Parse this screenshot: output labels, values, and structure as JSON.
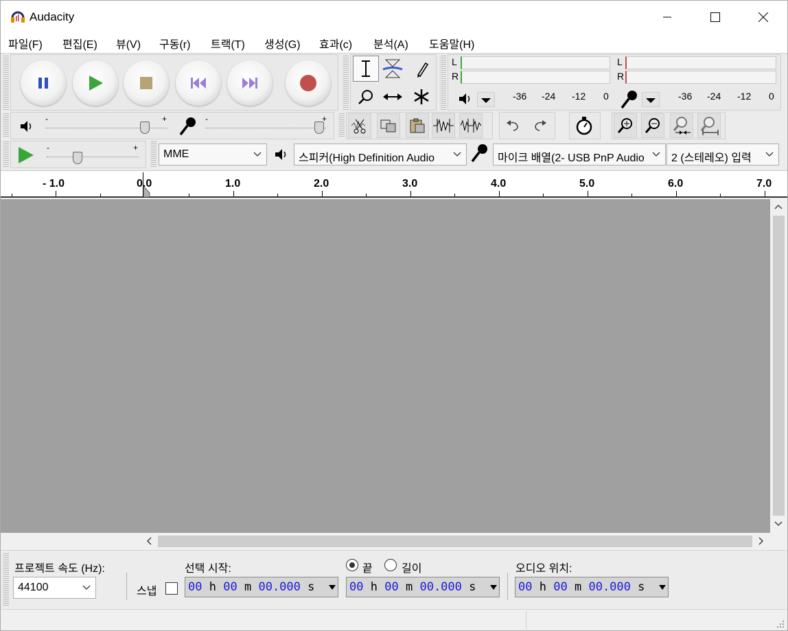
{
  "window": {
    "title": "Audacity"
  },
  "menu": [
    {
      "label": "파일(F)"
    },
    {
      "label": "편집(E)"
    },
    {
      "label": "뷰(V)"
    },
    {
      "label": "구동(r)"
    },
    {
      "label": "트랙(T)"
    },
    {
      "label": "생성(G)"
    },
    {
      "label": "효과(c)"
    },
    {
      "label": "분석(A)"
    },
    {
      "label": "도움말(H)"
    }
  ],
  "meters": {
    "playback": {
      "left": "L",
      "right": "R",
      "scale": [
        "-36",
        "-24",
        "-12",
        "0"
      ]
    },
    "record": {
      "left": "L",
      "right": "R",
      "scale": [
        "-36",
        "-24",
        "-12",
        "0"
      ]
    }
  },
  "sliders": {
    "minus": "-",
    "plus": "+"
  },
  "device": {
    "host": "MME",
    "output": "스피커(High Definition Audio",
    "input": "마이크 배열(2- USB PnP Audio",
    "channels": "2 (스테레오) 입력"
  },
  "ruler": {
    "labels": [
      "- 1.0",
      "0.0",
      "1.0",
      "2.0",
      "3.0",
      "4.0",
      "5.0",
      "6.0",
      "7.0"
    ]
  },
  "selection": {
    "rate_label": "프로젝트 속도 (Hz):",
    "rate_value": "44100",
    "snap_label": "스냅",
    "start_label": "선택 시작:",
    "end_label": "끝",
    "length_label": "길이",
    "position_label": "오디오 위치:",
    "time": {
      "hh": "00",
      "h": "h",
      "mm": "00",
      "m": "m",
      "ss": "00.000",
      "s": "s"
    }
  },
  "colors": {
    "play_green": "#3aa63a",
    "record_red": "#c0504d",
    "time_digits": "#1a1adb",
    "track_bg": "#a0a0a0"
  }
}
